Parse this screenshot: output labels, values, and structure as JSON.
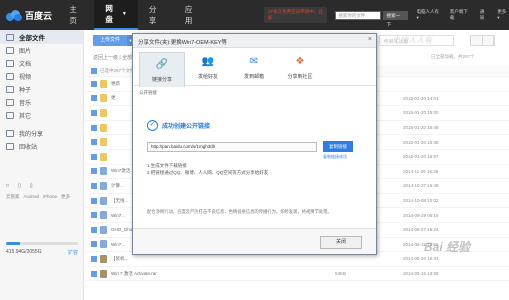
{
  "app": {
    "logo": "百度云"
  },
  "nav": {
    "tabs": [
      "主页",
      "网盘",
      "分享",
      "应用"
    ],
    "active_index": 1,
    "promo": "2T永久免费空间申请中，立即",
    "search_placeholder": "搜索你的文件",
    "search_button": "搜索一下",
    "links": [
      "电脑人人有 ▾",
      "客户端下载",
      "通知",
      "更多 ▾"
    ]
  },
  "sidebar": {
    "items": [
      {
        "label": "全部文件",
        "active": true
      },
      {
        "label": "图片"
      },
      {
        "label": "文档"
      },
      {
        "label": "视频"
      },
      {
        "label": "种子"
      },
      {
        "label": "音乐"
      },
      {
        "label": "其它"
      },
      {
        "label": "我的分享"
      },
      {
        "label": "回收站"
      }
    ],
    "devices": [
      "□",
      "▯",
      "▯"
    ],
    "device_labels": [
      "云管家",
      "Android",
      "iPhone",
      "更多"
    ],
    "quota": "415.94G/2055G",
    "quota_fraction": 0.2,
    "expand": "扩容"
  },
  "main": {
    "upload_label": "上传文件",
    "search_placeholder": "电脑人人有",
    "breadcrumb": "返回上一级 | 全部文件 > ...",
    "loaded_text": "已全部加载，共297个",
    "selected_text": "已选中297个文件/文件夹",
    "rows": [
      {
        "name": "更新",
        "size": "",
        "date": "",
        "type": "folder"
      },
      {
        "name": "更",
        "size": "",
        "date": "2015-01-20 14:01",
        "type": "folder"
      },
      {
        "name": "",
        "size": "",
        "date": "2015-01-20 15:00",
        "type": "folder"
      },
      {
        "name": "",
        "size": "",
        "date": "2015-01-20 15:48",
        "type": "folder"
      },
      {
        "name": "",
        "size": "",
        "date": "2015-01-20 15:48",
        "type": "folder"
      },
      {
        "name": "",
        "size": "",
        "date": "2015-01-20 15:57",
        "type": "folder"
      },
      {
        "name": "Win7激活...",
        "size": "",
        "date": "2014-11-29 16:36",
        "type": "doc"
      },
      {
        "name": "计算...",
        "size": "",
        "date": "2014-10-27 15:49",
        "type": "doc"
      },
      {
        "name": "【无线...",
        "size": "",
        "date": "2014-10-08 10:02",
        "type": "doc"
      },
      {
        "name": "Win7...",
        "size": "",
        "date": "2014-09-29 06:16",
        "type": "doc"
      },
      {
        "name": "GHO_Ghost...",
        "size": "",
        "date": "2014-06-27 15:24",
        "type": "doc"
      },
      {
        "name": "Win7...",
        "size": "",
        "date": "2014-06-11 12:51",
        "type": "doc"
      },
      {
        "name": "【装机...",
        "size": "",
        "date": "2014-05-20 16:31",
        "type": "zip"
      },
      {
        "name": "Win 7 激活 Activate.rar",
        "size": "63KB",
        "date": "2014-05-16 13:59",
        "type": "zip"
      }
    ],
    "tooltip": "单击即可免去下"
  },
  "dialog": {
    "title": "分享文件(夹):更换Win7-OEM-KEY等",
    "tabs": [
      {
        "label": "链接分享",
        "icon": "link-icon",
        "glyph": "🔗"
      },
      {
        "label": "发给好友",
        "icon": "friends-icon",
        "glyph": "👥"
      },
      {
        "label": "发到邮箱",
        "icon": "mail-icon",
        "glyph": "✉"
      },
      {
        "label": "分享到社区",
        "icon": "community-icon",
        "glyph": "❖"
      }
    ],
    "panel_label": "公开链接",
    "success": "成功创建公开链接",
    "link": "http://pan.baidu.com/s/1mgh3dlI",
    "copy_button": "复制链接",
    "copy_ok": "复制链接成功",
    "hints": [
      "1.生成文件下载链接",
      "2.把链接通过QQ、微博、人人网、QQ空间等方式分享给好友"
    ],
    "notice": "配合净网行动，百度云严厉打击不良信息，色情低俗信息的传播行为，如经发现，将视情节处理。",
    "close_button": "关闭"
  },
  "watermark": "Bai 经验",
  "watermark_top": "电脑人人有"
}
